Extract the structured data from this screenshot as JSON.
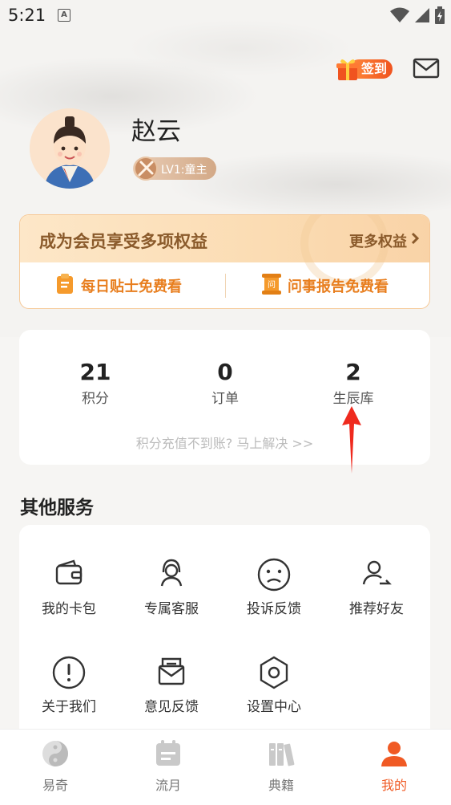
{
  "status_bar": {
    "time": "5:21",
    "notification_letter": "A"
  },
  "header": {
    "checkin_label": "签到",
    "mail_icon": "mail-icon"
  },
  "profile": {
    "name": "赵云",
    "level": "LV1:童主"
  },
  "vip": {
    "title": "成为会员享受多项权益",
    "more": "更多权益",
    "link1": "每日贴士免费看",
    "link2": "问事报告免费看"
  },
  "stats": {
    "items": [
      {
        "value": "21",
        "label": "积分"
      },
      {
        "value": "0",
        "label": "订单"
      },
      {
        "value": "2",
        "label": "生辰库"
      }
    ],
    "recharge_hint": "积分充值不到账? 马上解决 >>"
  },
  "services": {
    "title": "其他服务",
    "items": [
      {
        "label": "我的卡包",
        "icon": "wallet-icon"
      },
      {
        "label": "专属客服",
        "icon": "headset-icon"
      },
      {
        "label": "投诉反馈",
        "icon": "sad-face-icon"
      },
      {
        "label": "推荐好友",
        "icon": "share-user-icon"
      },
      {
        "label": "关于我们",
        "icon": "info-icon"
      },
      {
        "label": "意见反馈",
        "icon": "feedback-mail-icon"
      },
      {
        "label": "设置中心",
        "icon": "settings-hex-icon"
      }
    ]
  },
  "tabbar": {
    "items": [
      {
        "label": "易奇",
        "icon": "yinyang-icon"
      },
      {
        "label": "流月",
        "icon": "calendar-icon"
      },
      {
        "label": "典籍",
        "icon": "books-icon"
      },
      {
        "label": "我的",
        "icon": "profile-icon"
      }
    ],
    "active": "我的"
  },
  "colors": {
    "accent": "#f05a24",
    "vip_text": "#8a5a2b",
    "vip_link": "#e87e1e"
  }
}
